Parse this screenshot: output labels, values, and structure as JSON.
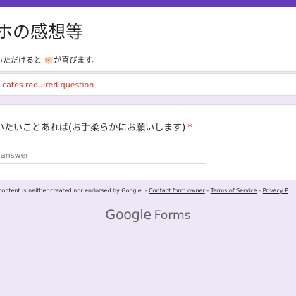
{
  "form": {
    "title": "ホの感想等",
    "description": "いただけると 🐖が喜びます。",
    "required_note": "dicates required question"
  },
  "question": {
    "text": "いたいことあれば(お手柔らかにお願いします)",
    "required_mark": "*",
    "answer_placeholder": "r answer"
  },
  "footer": {
    "disclaimer": "content is neither created nor endorsed by Google. - ",
    "contact_link": "Contact form owner",
    "sep1": " - ",
    "terms_link": "Terms of Service",
    "sep2": " - ",
    "privacy_link": "Privacy P"
  },
  "brand": {
    "google": "Google",
    "forms": "Forms"
  },
  "colors": {
    "accent": "#673ab7",
    "background": "#ede7f6",
    "required": "#d93025"
  }
}
